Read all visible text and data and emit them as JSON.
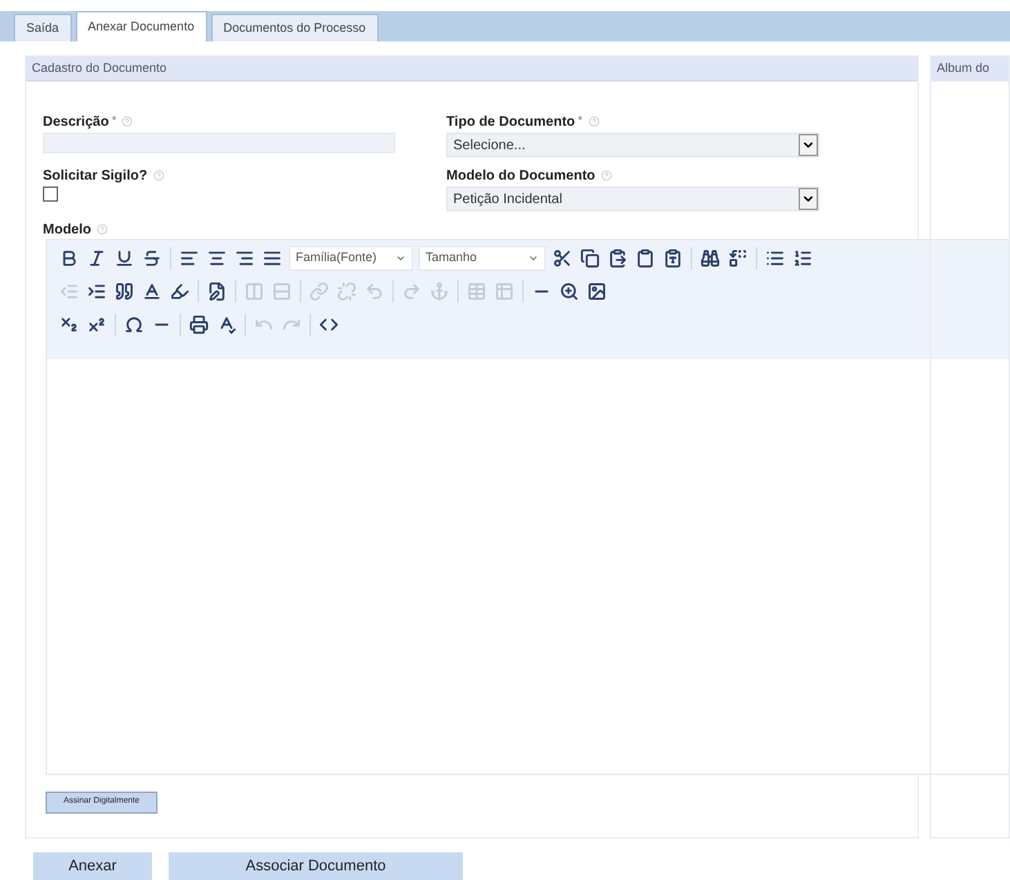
{
  "tabs": [
    {
      "label": "Saída",
      "selected": false
    },
    {
      "label": "Anexar Documento",
      "selected": true
    },
    {
      "label": "Documentos do Processo",
      "selected": false
    }
  ],
  "form_panel": {
    "title": "Cadastro do Documento",
    "fields": [
      {
        "kind": "text",
        "label": "Descrição",
        "required_mark": "*"
      },
      {
        "kind": "select",
        "label": "Tipo de Documento",
        "required_mark": "*",
        "value": "Selecione..."
      },
      {
        "kind": "checkbox",
        "label": "Solicitar Sigilo?",
        "checked": false
      },
      {
        "kind": "select",
        "label": "Modelo do Documento",
        "value": "Petição Incidental"
      }
    ],
    "editor_label": "Modelo",
    "toolbar_rows": [
      [
        {
          "kind": "bold",
          "disabled": false
        },
        {
          "kind": "italic",
          "disabled": false
        },
        {
          "kind": "underline",
          "disabled": false
        },
        {
          "kind": "strike",
          "disabled": false
        },
        {
          "kind": "sep"
        },
        {
          "kind": "alignleft",
          "disabled": false
        },
        {
          "kind": "aligncenter",
          "disabled": false
        },
        {
          "kind": "alignright",
          "disabled": false
        },
        {
          "kind": "justify",
          "disabled": false
        },
        {
          "kind": "font",
          "label": "Família(Fonte)"
        },
        {
          "kind": "size",
          "label": "Tamanho"
        },
        {
          "kind": "cut",
          "disabled": false
        },
        {
          "kind": "copy",
          "disabled": false
        },
        {
          "kind": "paste",
          "disabled": false
        },
        {
          "kind": "pastetext",
          "disabled": false
        },
        {
          "kind": "pasteword",
          "disabled": false
        },
        {
          "kind": "sep"
        },
        {
          "kind": "find",
          "disabled": false
        },
        {
          "kind": "replace",
          "disabled": false
        },
        {
          "kind": "sep"
        },
        {
          "kind": "bullets",
          "disabled": false
        },
        {
          "kind": "numbers",
          "disabled": false
        }
      ],
      [
        {
          "kind": "outdent",
          "disabled": true
        },
        {
          "kind": "indent",
          "disabled": false
        },
        {
          "kind": "quote",
          "disabled": false
        },
        {
          "kind": "textcolor",
          "disabled": false
        },
        {
          "kind": "highlight",
          "disabled": false
        },
        {
          "kind": "sep"
        },
        {
          "kind": "edit",
          "disabled": false
        },
        {
          "kind": "sep"
        },
        {
          "kind": "columns",
          "disabled": true
        },
        {
          "kind": "rows",
          "disabled": true
        },
        {
          "kind": "sep"
        },
        {
          "kind": "link",
          "disabled": true
        },
        {
          "kind": "unlink",
          "disabled": true
        },
        {
          "kind": "undo2",
          "disabled": true
        },
        {
          "kind": "sep"
        },
        {
          "kind": "redo2",
          "disabled": true
        },
        {
          "kind": "anchor",
          "disabled": true
        },
        {
          "kind": "sep"
        },
        {
          "kind": "table",
          "disabled": true
        },
        {
          "kind": "table2",
          "disabled": true
        },
        {
          "kind": "sep"
        },
        {
          "kind": "rule",
          "disabled": false
        },
        {
          "kind": "zoom",
          "disabled": false
        },
        {
          "kind": "image",
          "disabled": false
        }
      ],
      [
        {
          "kind": "subscript",
          "disabled": false
        },
        {
          "kind": "superscript",
          "disabled": false
        },
        {
          "kind": "sep"
        },
        {
          "kind": "omega",
          "disabled": false
        },
        {
          "kind": "dash",
          "disabled": false
        },
        {
          "kind": "sep"
        },
        {
          "kind": "print",
          "disabled": false
        },
        {
          "kind": "spell",
          "disabled": false
        },
        {
          "kind": "sep"
        },
        {
          "kind": "undo",
          "disabled": true
        },
        {
          "kind": "redo",
          "disabled": true
        },
        {
          "kind": "sep"
        },
        {
          "kind": "source",
          "disabled": false
        }
      ]
    ],
    "sign_button": "Assinar Digitalmente"
  },
  "side_panel": {
    "title": "Album do"
  },
  "buttons": [
    "Anexar",
    "Associar Documento"
  ]
}
